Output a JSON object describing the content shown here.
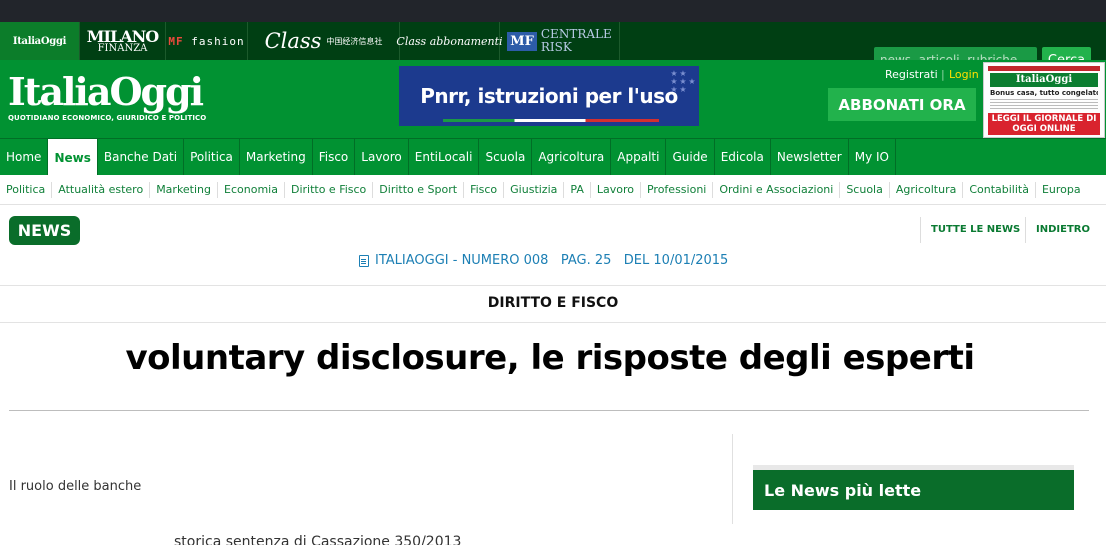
{
  "group_logos": {
    "italiaoggi": "ItaliaOggi",
    "milano_finanza_line1": "MILANO",
    "milano_finanza_line2": "FINANZA",
    "mf": "MF",
    "fashion": "fashion",
    "class": "Class",
    "class_cn": "中国经济信息社",
    "class_abbonamenti": "Class abbonamenti",
    "mf_risk_box": "MF",
    "centrale": "CENTRALE",
    "risk": "RISK"
  },
  "search": {
    "placeholder": "news, articoli, rubriche",
    "button": "Cerca"
  },
  "header": {
    "brand": "ItaliaOggi",
    "tagline": "QUOTIDIANO ECONOMICO, GIURIDICO E POLITICO",
    "banner_text": "Pnrr, istruzioni per l'uso",
    "registrati": "Registrati",
    "login": "Login",
    "abbonati": "ABBONATI ORA",
    "paper_masthead": "ItaliaOggi",
    "paper_headline": "Bonus casa, tutto congelato",
    "paper_cta": "LEGGI IL GIORNALE DI OGGI ONLINE"
  },
  "nav": [
    "Home",
    "News",
    "Banche Dati",
    "Politica",
    "Marketing",
    "Fisco",
    "Lavoro",
    "EntiLocali",
    "Scuola",
    "Agricoltura",
    "Appalti",
    "Guide",
    "Edicola",
    "Newsletter",
    "My IO"
  ],
  "nav_active": "News",
  "subnav": [
    "Politica",
    "Attualità estero",
    "Marketing",
    "Economia",
    "Diritto e Fisco",
    "Diritto e Sport",
    "Fisco",
    "Giustizia",
    "PA",
    "Lavoro",
    "Professioni",
    "Ordini e Associazioni",
    "Scuola",
    "Agricoltura",
    "Contabilità",
    "Europa"
  ],
  "content": {
    "badge": "NEWS",
    "tutte": "TUTTE LE NEWS",
    "indietro": "INDIETRO",
    "issue": "ITALIAOGGI - NUMERO 008   PAG. 25   DEL 10/01/2015",
    "section": "DIRITTO E FISCO",
    "headline": "voluntary disclosure, le risposte degli esperti",
    "ruolo": "Il ruolo delle banche",
    "sidebar_title": "Le News più lette",
    "peek_line2": "storica sentenza di Cassazione 350/2013"
  }
}
